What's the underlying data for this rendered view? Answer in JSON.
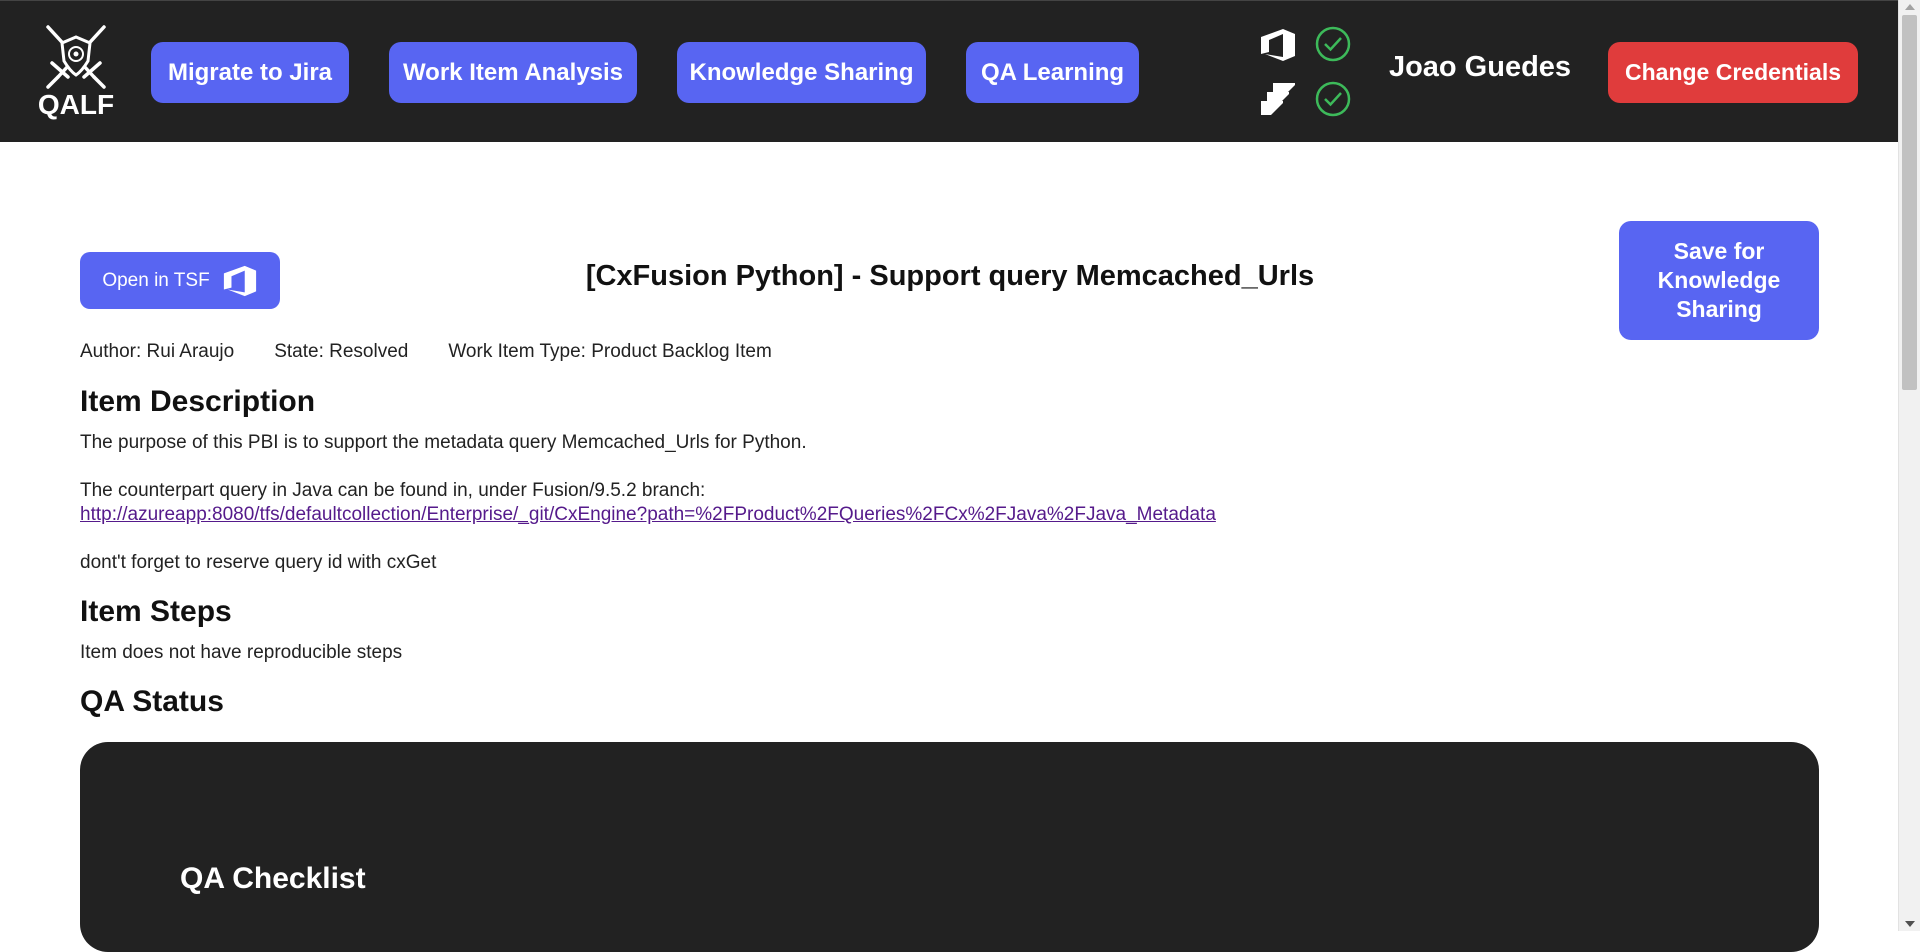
{
  "header": {
    "logo_text": "QALF",
    "nav": [
      {
        "label": "Migrate to Jira"
      },
      {
        "label": "Work Item Analysis"
      },
      {
        "label": "Knowledge Sharing"
      },
      {
        "label": "QA Learning"
      }
    ],
    "connections": [
      {
        "icon": "azure-devops-icon",
        "status": "connected",
        "status_icon": "check-circle-icon"
      },
      {
        "icon": "jira-icon",
        "status": "connected",
        "status_icon": "check-circle-icon"
      }
    ],
    "user_name": "Joao Guedes",
    "change_credentials_label": "Change Credentials"
  },
  "work_item": {
    "open_button_label": "Open in TSF",
    "title": "[CxFusion Python] - Support query Memcached_Urls",
    "save_button_label": "Save for Knowledge Sharing",
    "author": "Author: Rui Araujo",
    "state": "State: Resolved",
    "type": "Work Item Type: Product Backlog Item"
  },
  "description": {
    "heading": "Item Description",
    "line1": "The purpose of this PBI is to support the metadata query Memcached_Urls for Python.",
    "line2": "The counterpart query in Java can be found in, under Fusion/9.5.2 branch:",
    "link": "http://azureapp:8080/tfs/defaultcollection/Enterprise/_git/CxEngine?path=%2FProduct%2FQueries%2FCx%2FJava%2FJava_Metadata",
    "line3": "dont't forget to reserve query id with cxGet"
  },
  "steps": {
    "heading": "Item Steps",
    "text": "Item does not have reproducible steps"
  },
  "qa": {
    "heading": "QA Status",
    "checklist_title": "QA Checklist"
  },
  "colors": {
    "header_bg": "#222222",
    "primary": "#5865f2",
    "danger": "#e03c3c",
    "success": "#3dba5a",
    "link": "#551a8b"
  }
}
